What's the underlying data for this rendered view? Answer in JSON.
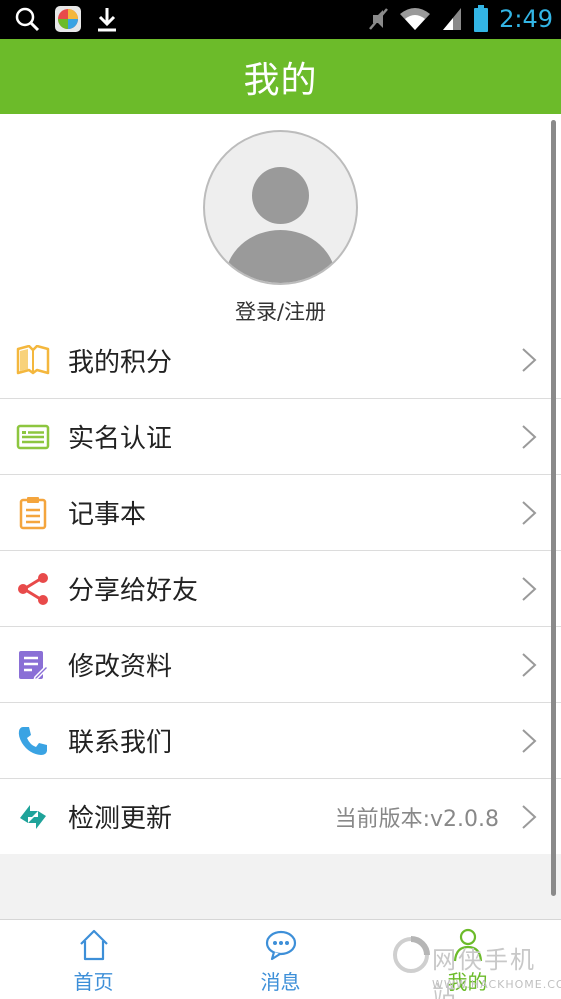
{
  "status_bar": {
    "time": "2:49",
    "icons": [
      "search-icon",
      "app-store-icon",
      "download-icon",
      "mute-icon",
      "wifi-icon",
      "signal-icon",
      "battery-icon"
    ]
  },
  "header": {
    "title": "我的"
  },
  "profile": {
    "login_text": "登录/注册"
  },
  "menu": {
    "items": [
      {
        "label": "我的积分",
        "icon": "book-icon",
        "color": "#f4b73d"
      },
      {
        "label": "实名认证",
        "icon": "id-card-icon",
        "color": "#8dc63f"
      },
      {
        "label": "记事本",
        "icon": "clipboard-icon",
        "color": "#f4a53d"
      },
      {
        "label": "分享给好友",
        "icon": "share-icon",
        "color": "#e84a4a"
      },
      {
        "label": "修改资料",
        "icon": "edit-icon",
        "color": "#8a6fd6"
      },
      {
        "label": "联系我们",
        "icon": "phone-icon",
        "color": "#3aa3e3"
      },
      {
        "label": "检测更新",
        "icon": "sync-icon",
        "color": "#1fa39a",
        "value": "当前版本:v2.0.8"
      }
    ]
  },
  "tabs": [
    {
      "label": "首页",
      "icon": "home-icon"
    },
    {
      "label": "消息",
      "icon": "message-icon"
    },
    {
      "label": "我的",
      "icon": "user-icon",
      "active": true
    }
  ],
  "watermark": {
    "text": "网侠手机站",
    "url": "WWW.HACKHOME.COM"
  },
  "colors": {
    "accent": "#6cbb2a",
    "tab_text": "#3d8fd8"
  }
}
